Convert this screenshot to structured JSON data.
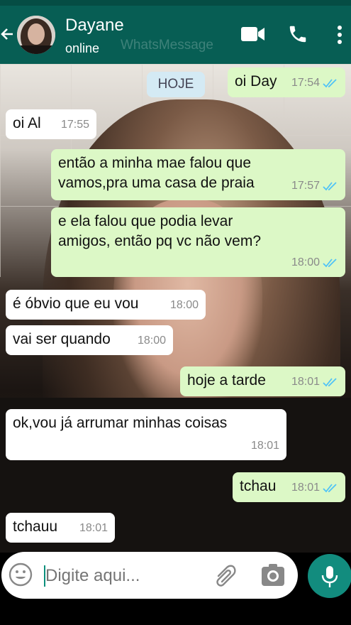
{
  "header": {
    "contact_name": "Dayane",
    "status": "online",
    "watermark": "WhatsMessage",
    "icons": [
      "back-arrow-icon",
      "video-call-icon",
      "voice-call-icon",
      "more-options-icon"
    ]
  },
  "chat": {
    "date_chip": "HOJE",
    "messages": [
      {
        "dir": "out",
        "text": "oi Day",
        "time": "17:54",
        "read": true
      },
      {
        "dir": "in",
        "text": "oi Al",
        "time": "17:55"
      },
      {
        "dir": "out",
        "text": "então a minha mae falou que vamos,pra uma casa de praia",
        "time": "17:57",
        "read": true
      },
      {
        "dir": "out",
        "text": "e ela falou que podia levar amigos, então pq vc não vem?",
        "time": "18:00",
        "read": true
      },
      {
        "dir": "in",
        "text": "é óbvio que eu vou",
        "time": "18:00"
      },
      {
        "dir": "in",
        "text": "vai ser quando",
        "time": "18:00"
      },
      {
        "dir": "out",
        "text": "hoje a tarde",
        "time": "18:01",
        "read": true
      },
      {
        "dir": "in",
        "text": "ok,vou já arrumar minhas coisas",
        "time": "18:01"
      },
      {
        "dir": "out",
        "text": "tchau",
        "time": "18:01",
        "read": true
      },
      {
        "dir": "in",
        "text": "tchauu",
        "time": "18:01"
      }
    ]
  },
  "composer": {
    "placeholder": "Digite aqui...",
    "icons": [
      "emoji-icon",
      "attach-icon",
      "camera-icon",
      "mic-icon"
    ]
  },
  "colors": {
    "header": "#075e54",
    "outgoing_bubble": "#dcf8c6",
    "incoming_bubble": "#ffffff",
    "read_ticks": "#4fc3f7",
    "mic_button": "#128c7e"
  }
}
